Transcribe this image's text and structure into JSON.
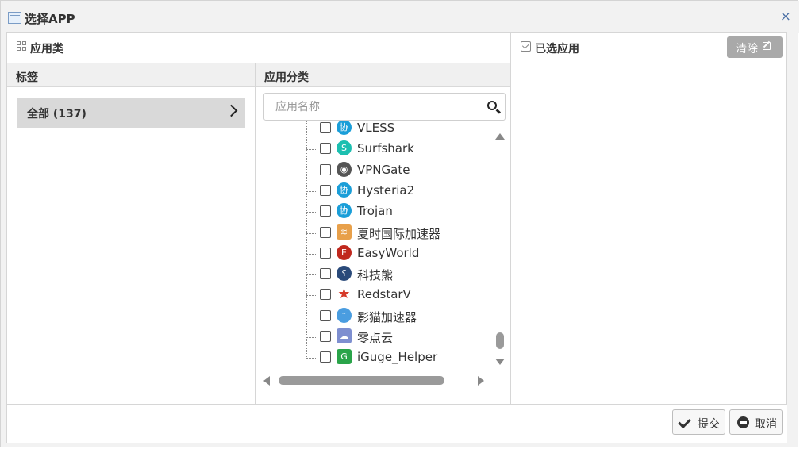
{
  "window": {
    "title": "选择APP",
    "close_glyph": "×"
  },
  "left_panel": {
    "header": "应用类",
    "tag_column": {
      "header": "标签",
      "all_item": "全部 (137)"
    },
    "category_column": {
      "header": "应用分类",
      "search_placeholder": "应用名称",
      "items": [
        {
          "name": "VLESS",
          "icon": "xie-protocol-icon",
          "color": "#1a9ed8"
        },
        {
          "name": "Surfshark",
          "icon": "surfshark-icon",
          "color": "#1cbfb0"
        },
        {
          "name": "VPNGate",
          "icon": "globe-icon",
          "color": "#555555"
        },
        {
          "name": "Hysteria2",
          "icon": "xie-protocol-icon",
          "color": "#1a9ed8"
        },
        {
          "name": "Trojan",
          "icon": "xie-protocol-icon",
          "color": "#1a9ed8"
        },
        {
          "name": "夏时国际加速器",
          "icon": "rainbow-icon",
          "color": "#e8a04a"
        },
        {
          "name": "EasyWorld",
          "icon": "easyworld-icon",
          "color": "#c0281e"
        },
        {
          "name": "科技熊",
          "icon": "bear-icon",
          "color": "#2a4a7a"
        },
        {
          "name": "RedstarV",
          "icon": "red-star-icon",
          "color": "#d63a2a"
        },
        {
          "name": "影猫加速器",
          "icon": "cat-icon",
          "color": "#4a9de0"
        },
        {
          "name": "零点云",
          "icon": "cloud-icon",
          "color": "#7e8fd0"
        },
        {
          "name": "iGuge_Helper",
          "icon": "iguge-icon",
          "color": "#2aa44a"
        }
      ]
    }
  },
  "right_panel": {
    "header": "已选应用",
    "clear_label": "清除"
  },
  "footer": {
    "submit_label": "提交",
    "cancel_label": "取消"
  }
}
